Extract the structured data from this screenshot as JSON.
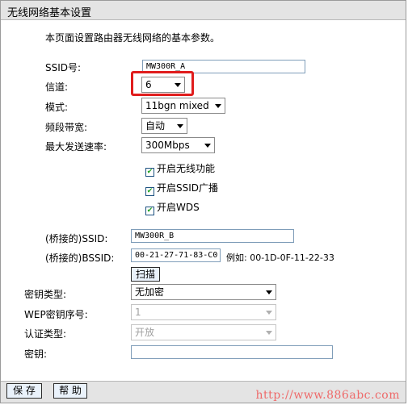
{
  "page": {
    "title": "无线网络基本设置",
    "description": "本页面设置路由器无线网络的基本参数。"
  },
  "fields": {
    "ssid_label": "SSID号:",
    "ssid_value": "MW300R_A",
    "channel_label": "信道:",
    "channel_value": "6",
    "mode_label": "模式:",
    "mode_value": "11bgn mixed",
    "bandwidth_label": "频段带宽:",
    "bandwidth_value": "自动",
    "rate_label": "最大发送速率:",
    "rate_value": "300Mbps"
  },
  "checkboxes": {
    "wireless": {
      "label": "开启无线功能",
      "checked": true
    },
    "ssid_broadcast": {
      "label": "开启SSID广播",
      "checked": true
    },
    "wds": {
      "label": "开启WDS",
      "checked": true
    }
  },
  "wds": {
    "bridge_ssid_label": "(桥接的)SSID:",
    "bridge_ssid_value": "MW300R_B",
    "bridge_bssid_label": "(桥接的)BSSID:",
    "bridge_bssid_value": "00-21-27-71-83-C0",
    "bssid_example": "例如: 00-1D-0F-11-22-33",
    "scan_button": "扫描",
    "key_type_label": "密钥类型:",
    "key_type_value": "无加密",
    "wep_index_label": "WEP密钥序号:",
    "wep_index_value": "1",
    "auth_type_label": "认证类型:",
    "auth_type_value": "开放",
    "key_label": "密钥:",
    "key_value": ""
  },
  "buttons": {
    "save": "保 存",
    "help": "帮 助"
  },
  "watermark": "http://www.886abc.com",
  "colors": {
    "highlight": "#e01d1d",
    "watermark": "#ee6a6a"
  }
}
